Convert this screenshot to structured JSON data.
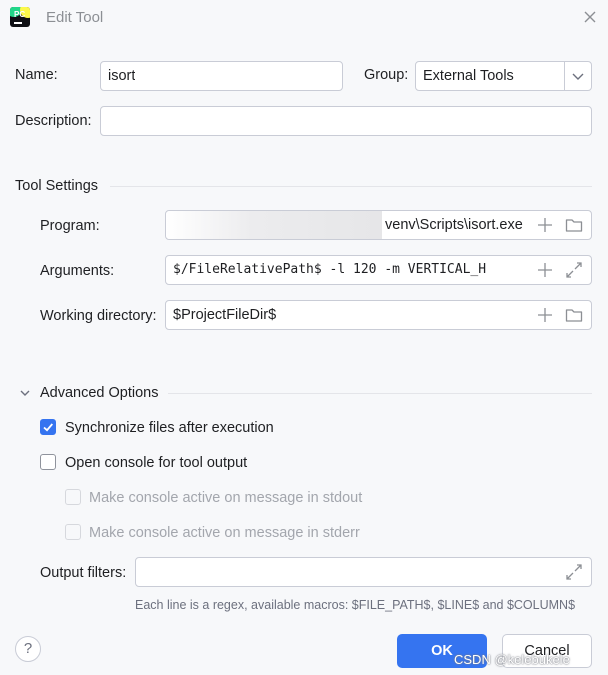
{
  "window": {
    "title": "Edit Tool"
  },
  "form": {
    "name_label": "Name:",
    "name_value": "isort",
    "group_label": "Group:",
    "group_value": "External Tools",
    "description_label": "Description:",
    "description_value": ""
  },
  "tool_settings": {
    "heading": "Tool Settings",
    "program_label": "Program:",
    "program_value": "venv\\Scripts\\isort.exe",
    "arguments_label": "Arguments:",
    "arguments_value": "$/FileRelativePath$ -l 120 -m VERTICAL_H",
    "workdir_label": "Working directory:",
    "workdir_value": "$ProjectFileDir$"
  },
  "advanced": {
    "heading": "Advanced Options",
    "sync_label": "Synchronize files after execution",
    "sync_checked": true,
    "console_label": "Open console for tool output",
    "console_checked": false,
    "stdout_label": "Make console active on message in stdout",
    "stderr_label": "Make console active on message in stderr",
    "output_filters_label": "Output filters:",
    "output_filters_value": "",
    "hint": "Each line is a regex, available macros: $FILE_PATH$, $LINE$ and $COLUMN$"
  },
  "buttons": {
    "ok": "OK",
    "cancel": "Cancel",
    "help": "?"
  },
  "watermark": "CSDN @kelebukele",
  "colors": {
    "accent": "#3574f0",
    "background": "#f7f8fa"
  }
}
